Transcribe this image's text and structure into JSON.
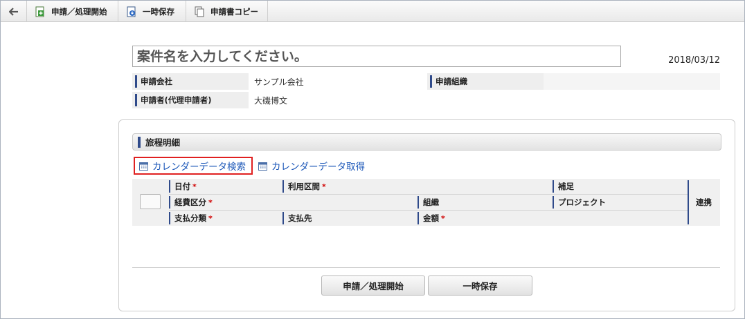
{
  "toolbar": {
    "back_icon": "arrow-left-icon",
    "apply_label": "申請／処理開始",
    "save_label": "一時保存",
    "copy_label": "申請書コピー"
  },
  "header": {
    "title_placeholder": "案件名を入力してください。",
    "date": "2018/03/12"
  },
  "info": {
    "company_label": "申請会社",
    "company_value": "サンプル会社",
    "org_label": "申請組織",
    "org_value": "",
    "applicant_label": "申請者(代理申請者)",
    "applicant_value": "大磯博文"
  },
  "section": {
    "title": "旅程明細",
    "calendar_search": "カレンダーデータ検索",
    "calendar_fetch": "カレンダーデータ取得"
  },
  "grid": {
    "date": "日付",
    "route": "利用区間",
    "note": "補足",
    "expense_type": "経費区分",
    "org": "組織",
    "project": "プロジェクト",
    "pay_type": "支払分類",
    "payee": "支払先",
    "amount": "金額",
    "link": "連携",
    "required_mark": "*"
  },
  "actions": {
    "apply_label": "申請／処理開始",
    "save_label": "一時保存"
  },
  "colors": {
    "accent": "#2f4a8a",
    "link": "#1a56b8",
    "highlight": "#e02020",
    "required": "#d00000"
  }
}
